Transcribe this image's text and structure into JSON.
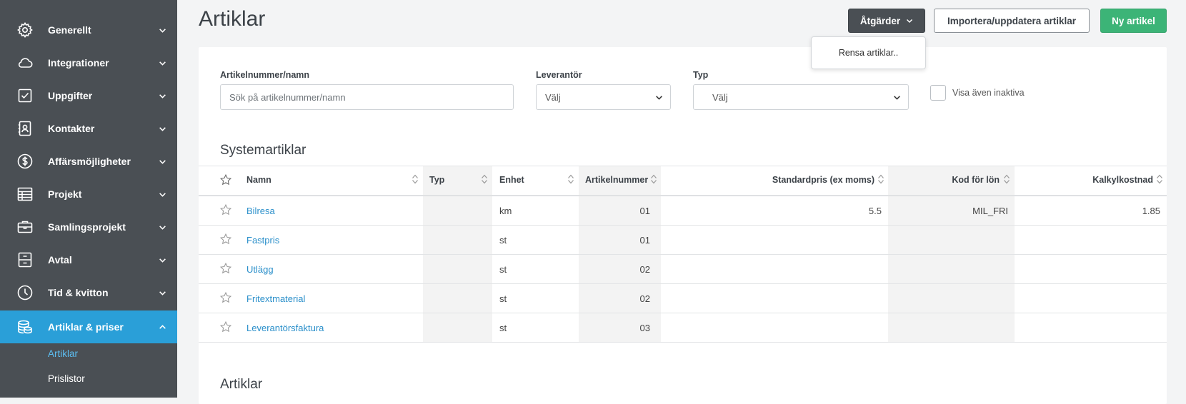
{
  "sidebar": {
    "items": [
      {
        "label": "Generellt",
        "icon": "gear-icon"
      },
      {
        "label": "Integrationer",
        "icon": "cloud-icon"
      },
      {
        "label": "Uppgifter",
        "icon": "checkbox-icon"
      },
      {
        "label": "Kontakter",
        "icon": "contact-card-icon"
      },
      {
        "label": "Affärsmöjligheter",
        "icon": "dollar-circle-icon"
      },
      {
        "label": "Projekt",
        "icon": "table-grid-icon"
      },
      {
        "label": "Samlingsprojekt",
        "icon": "briefcase-icon"
      },
      {
        "label": "Avtal",
        "icon": "archive-drawer-icon"
      },
      {
        "label": "Tid & kvitton",
        "icon": "clock-icon"
      },
      {
        "label": "Artiklar & priser",
        "icon": "coin-stack-icon",
        "active": true
      }
    ],
    "subitems": [
      {
        "label": "Artiklar",
        "active": true
      },
      {
        "label": "Prislistor"
      }
    ]
  },
  "header": {
    "title": "Artiklar",
    "actions_label": "Åtgärder",
    "import_label": "Importera/uppdatera artiklar",
    "new_label": "Ny artikel",
    "dropdown_item": "Rensa artiklar.."
  },
  "filters": {
    "article_label": "Artikelnummer/namn",
    "article_placeholder": "Sök på artikelnummer/namn",
    "supplier_label": "Leverantör",
    "supplier_value": "Välj",
    "type_label": "Typ",
    "type_value": "Välj",
    "inactive_label": "Visa även inaktiva"
  },
  "system_section": {
    "title": "Systemartiklar",
    "columns": [
      "Namn",
      "Typ",
      "Enhet",
      "Artikelnummer",
      "Standardpris (ex moms)",
      "Kod för lön",
      "Kalkylkostnad"
    ],
    "rows": [
      {
        "name": "Bilresa",
        "type": "",
        "unit": "km",
        "number": "01",
        "price": "5.5",
        "salary_code": "MIL_FRI",
        "cost": "1.85"
      },
      {
        "name": "Fastpris",
        "type": "",
        "unit": "st",
        "number": "01",
        "price": "",
        "salary_code": "",
        "cost": ""
      },
      {
        "name": "Utlägg",
        "type": "",
        "unit": "st",
        "number": "02",
        "price": "",
        "salary_code": "",
        "cost": ""
      },
      {
        "name": "Fritextmaterial",
        "type": "",
        "unit": "st",
        "number": "02",
        "price": "",
        "salary_code": "",
        "cost": ""
      },
      {
        "name": "Leverantörsfaktura",
        "type": "",
        "unit": "st",
        "number": "03",
        "price": "",
        "salary_code": "",
        "cost": ""
      }
    ]
  },
  "articles_section": {
    "title": "Artiklar"
  }
}
